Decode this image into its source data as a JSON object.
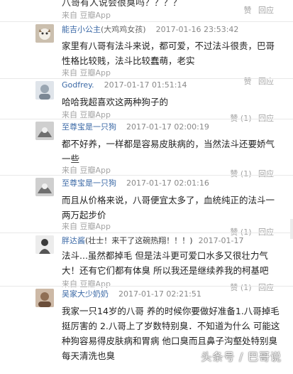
{
  "top": {
    "text": "八哥有人说会很臭吗？？？？",
    "source": "来自 豆瓣App",
    "like": "赞",
    "reply": "回应"
  },
  "comments": [
    {
      "nick": "能吉小公主",
      "tail": "(大鸡鸡女孩)",
      "time": "2017-01-16 23:53:42",
      "text": "家里有八哥有法斗来说，都可爱，不过法斗很贵，巴哥性格比较贱，法斗比较蠢萌，老实",
      "source": "来自 豆瓣App",
      "like": "赞",
      "reply": "回应"
    },
    {
      "nick": "Godfrey.",
      "tail": "",
      "time": "2017-01-17 01:51:14",
      "text": "哈哈我超喜欢这两种狗子的",
      "source": "来自 豆瓣App",
      "like": "赞 (1)",
      "reply": "回应"
    },
    {
      "nick": "至尊宝是一只狗",
      "tail": "",
      "time": "2017-01-17 02:00:19",
      "text": "都不好养，一样都是容易皮肤病的，当然法斗还要娇气一些",
      "source": "来自 豆瓣App",
      "like": "赞 (1)",
      "reply": "回应"
    },
    {
      "nick": "至尊宝是一只狗",
      "tail": "",
      "time": "2017-01-17 02:01:16",
      "text": "而且从价格来说，八哥便宜太多了，血统纯正的法斗一两万起步价",
      "source": "来自 豆瓣App",
      "like": "赞 (1)",
      "reply": "回应"
    },
    {
      "nick": "胖达酱",
      "tail": "(壮士！来干了这碗热翔！！！)",
      "time": "2017-01-17",
      "text": "法斗...虽然都掉毛 但是法斗更可爱口水多又很壮力气大！还有它们都有体臭 所以我还是继续养我的柯基吧",
      "source": "来自 豆瓣App",
      "like": "赞 (1)",
      "reply": "回应"
    },
    {
      "nick": "吴家大少奶奶",
      "tail": "",
      "time": "2017-01-17 02:21:51",
      "text": "我家一只14岁的八哥 养的时候你要做好准备1.八哥掉毛挺厉害的 2.八哥上了岁数特别臭．不知道为什么 可能这种狗容易得皮肤病和胃病 他口臭而且鼻子沟壑处特别臭 每天清洗也臭",
      "source": "",
      "like": "",
      "reply": ""
    }
  ],
  "watermark": "头条号 / 巴哥说",
  "colors": {
    "nick": "#3b69a6",
    "meta": "#a3a3a3",
    "separator": "#e8e8e8"
  }
}
